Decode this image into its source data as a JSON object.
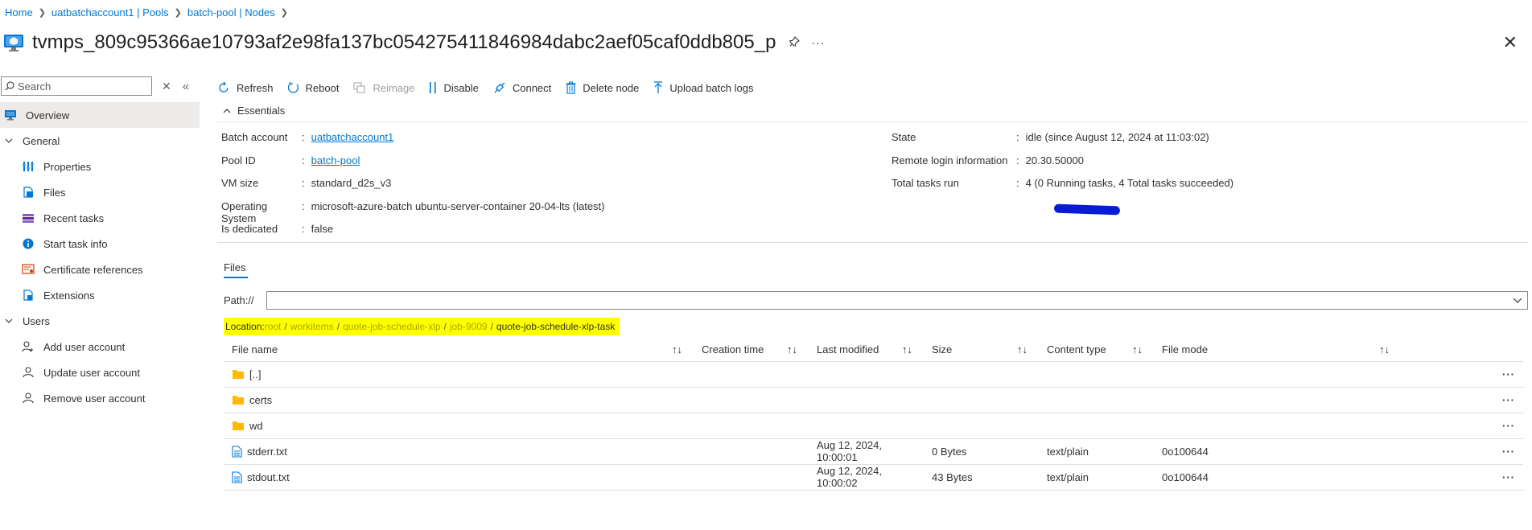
{
  "breadcrumb": [
    "Home",
    "uatbatchaccount1 | Pools",
    "batch-pool | Nodes"
  ],
  "title": "tvmps_809c95366ae10793af2e98fa137bc054275411846984dabc2aef05caf0ddb805_p",
  "search": {
    "placeholder": "Search"
  },
  "sidebar": {
    "overview": "Overview",
    "groups": [
      {
        "label": "General",
        "items": [
          "Properties",
          "Files",
          "Recent tasks",
          "Start task info",
          "Certificate references",
          "Extensions"
        ]
      },
      {
        "label": "Users",
        "items": [
          "Add user account",
          "Update user account",
          "Remove user account"
        ]
      }
    ]
  },
  "toolbar": {
    "refresh": "Refresh",
    "reboot": "Reboot",
    "reimage": "Reimage",
    "disable": "Disable",
    "connect": "Connect",
    "delete": "Delete node",
    "upload": "Upload batch logs"
  },
  "essentials": {
    "heading": "Essentials",
    "left": [
      {
        "label": "Batch account",
        "value": "uatbatchaccount1",
        "link": true
      },
      {
        "label": "Pool ID",
        "value": "batch-pool",
        "link": true
      },
      {
        "label": "VM size",
        "value": "standard_d2s_v3",
        "link": false
      },
      {
        "label": "Operating System",
        "value": "microsoft-azure-batch ubuntu-server-container 20-04-lts (latest)",
        "link": false
      },
      {
        "label": "Is dedicated",
        "value": "false",
        "link": false
      }
    ],
    "right": [
      {
        "label": "State",
        "value": "idle (since August 12, 2024 at 11:03:02)"
      },
      {
        "label": "Remote login information",
        "value": "20.30.50000"
      },
      {
        "label": "Total tasks run",
        "value": "4 (0 Running tasks, 4 Total tasks succeeded)"
      }
    ]
  },
  "files": {
    "tab": "Files",
    "path_label": "Path://",
    "location_prefix": "Location: ",
    "location_parts": [
      "root",
      "workitems",
      "quote-job-schedule-xlp",
      "job-9009",
      "quote-job-schedule-xlp-task"
    ],
    "columns": [
      "File name",
      "Creation time",
      "Last modified",
      "Size",
      "Content type",
      "File mode"
    ],
    "rows": [
      {
        "name": "[..]",
        "type": "folder",
        "created": "",
        "modified": "",
        "size": "",
        "content_type": "",
        "mode": ""
      },
      {
        "name": "certs",
        "type": "folder",
        "created": "",
        "modified": "",
        "size": "",
        "content_type": "",
        "mode": ""
      },
      {
        "name": "wd",
        "type": "folder",
        "created": "",
        "modified": "",
        "size": "",
        "content_type": "",
        "mode": ""
      },
      {
        "name": "stderr.txt",
        "type": "file",
        "created": "",
        "modified": "Aug 12, 2024, 10:00:01",
        "size": "0 Bytes",
        "content_type": "text/plain",
        "mode": "0o100644"
      },
      {
        "name": "stdout.txt",
        "type": "file",
        "created": "",
        "modified": "Aug 12, 2024, 10:00:02",
        "size": "43 Bytes",
        "content_type": "text/plain",
        "mode": "0o100644"
      }
    ]
  },
  "colors": {
    "accent": "#0078d4",
    "highlight": "#ffff00",
    "folder": "#ffb900"
  }
}
